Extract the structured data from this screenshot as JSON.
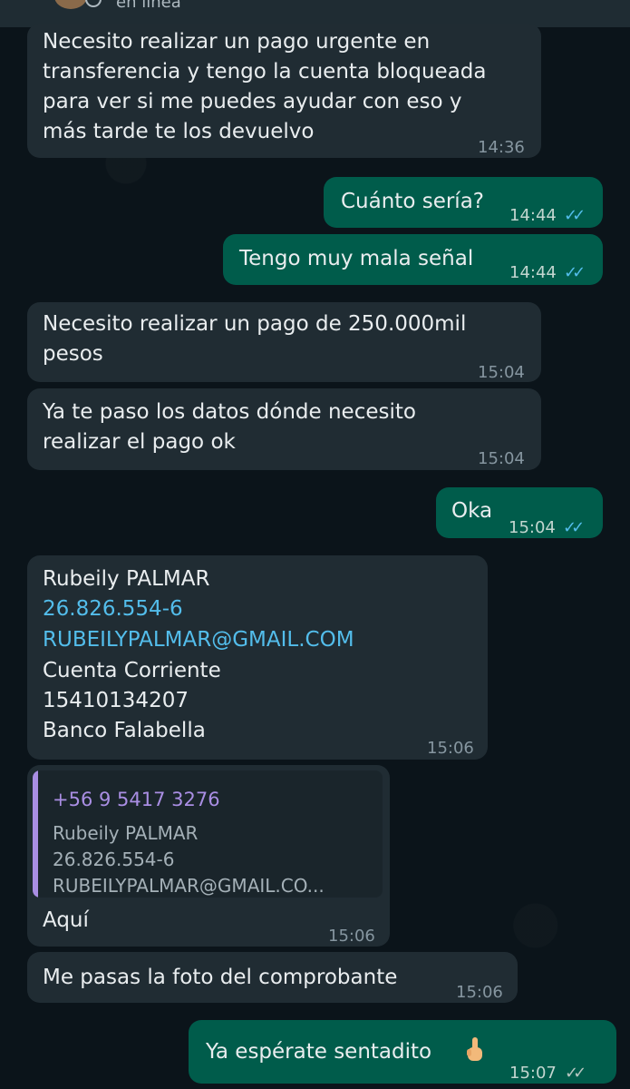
{
  "header": {
    "status": "en línea"
  },
  "messages": [
    {
      "direction": "in",
      "lines": [
        "Necesito realizar un pago urgente en",
        "transferencia y tengo la cuenta bloqueada",
        "para ver si me puedes ayudar con eso y",
        "más tarde te los devuelvo"
      ],
      "time": "14:36"
    },
    {
      "direction": "out",
      "lines": [
        "Cuánto sería?"
      ],
      "time": "14:44",
      "ticks": "✓✓"
    },
    {
      "direction": "out",
      "lines": [
        "Tengo muy mala señal"
      ],
      "time": "14:44",
      "ticks": "✓✓"
    },
    {
      "direction": "in",
      "lines": [
        "Necesito realizar un pago de 250.000mil",
        "pesos"
      ],
      "time": "15:04"
    },
    {
      "direction": "in",
      "lines": [
        "Ya te paso los datos dónde necesito",
        "realizar el pago ok"
      ],
      "time": "15:04"
    },
    {
      "direction": "out",
      "lines": [
        "Oka"
      ],
      "time": "15:04",
      "ticks": "✓✓"
    },
    {
      "direction": "in",
      "lines": [
        "Rubeily PALMAR",
        "26.826.554-6",
        "RUBEILYPALMAR@GMAIL.COM",
        "Cuenta Corriente",
        "15410134207",
        "Banco Falabella"
      ],
      "time": "15:06"
    },
    {
      "direction": "in",
      "quote": {
        "title": "+56 9 5417 3276",
        "lines": [
          "Rubeily PALMAR",
          "26.826.554-6",
          "RUBEILYPALMAR@GMAIL.CO..."
        ]
      },
      "lines": [
        "Aquí"
      ],
      "time": "15:06"
    },
    {
      "direction": "in",
      "lines": [
        "Me pasas la foto del comprobante"
      ],
      "time": "15:06"
    },
    {
      "direction": "out",
      "lines": [
        "Ya espérate sentadito"
      ],
      "time": "15:07",
      "ticks": "✓✓",
      "emoji": "pointing-finger"
    }
  ],
  "colors": {
    "background": "#0b141a",
    "incoming_bubble": "#202c33",
    "outgoing_bubble": "#005c4b",
    "read_ticks": "#53bdeb",
    "link": "#53bdeb",
    "quote_accent": "#a98ee3"
  }
}
